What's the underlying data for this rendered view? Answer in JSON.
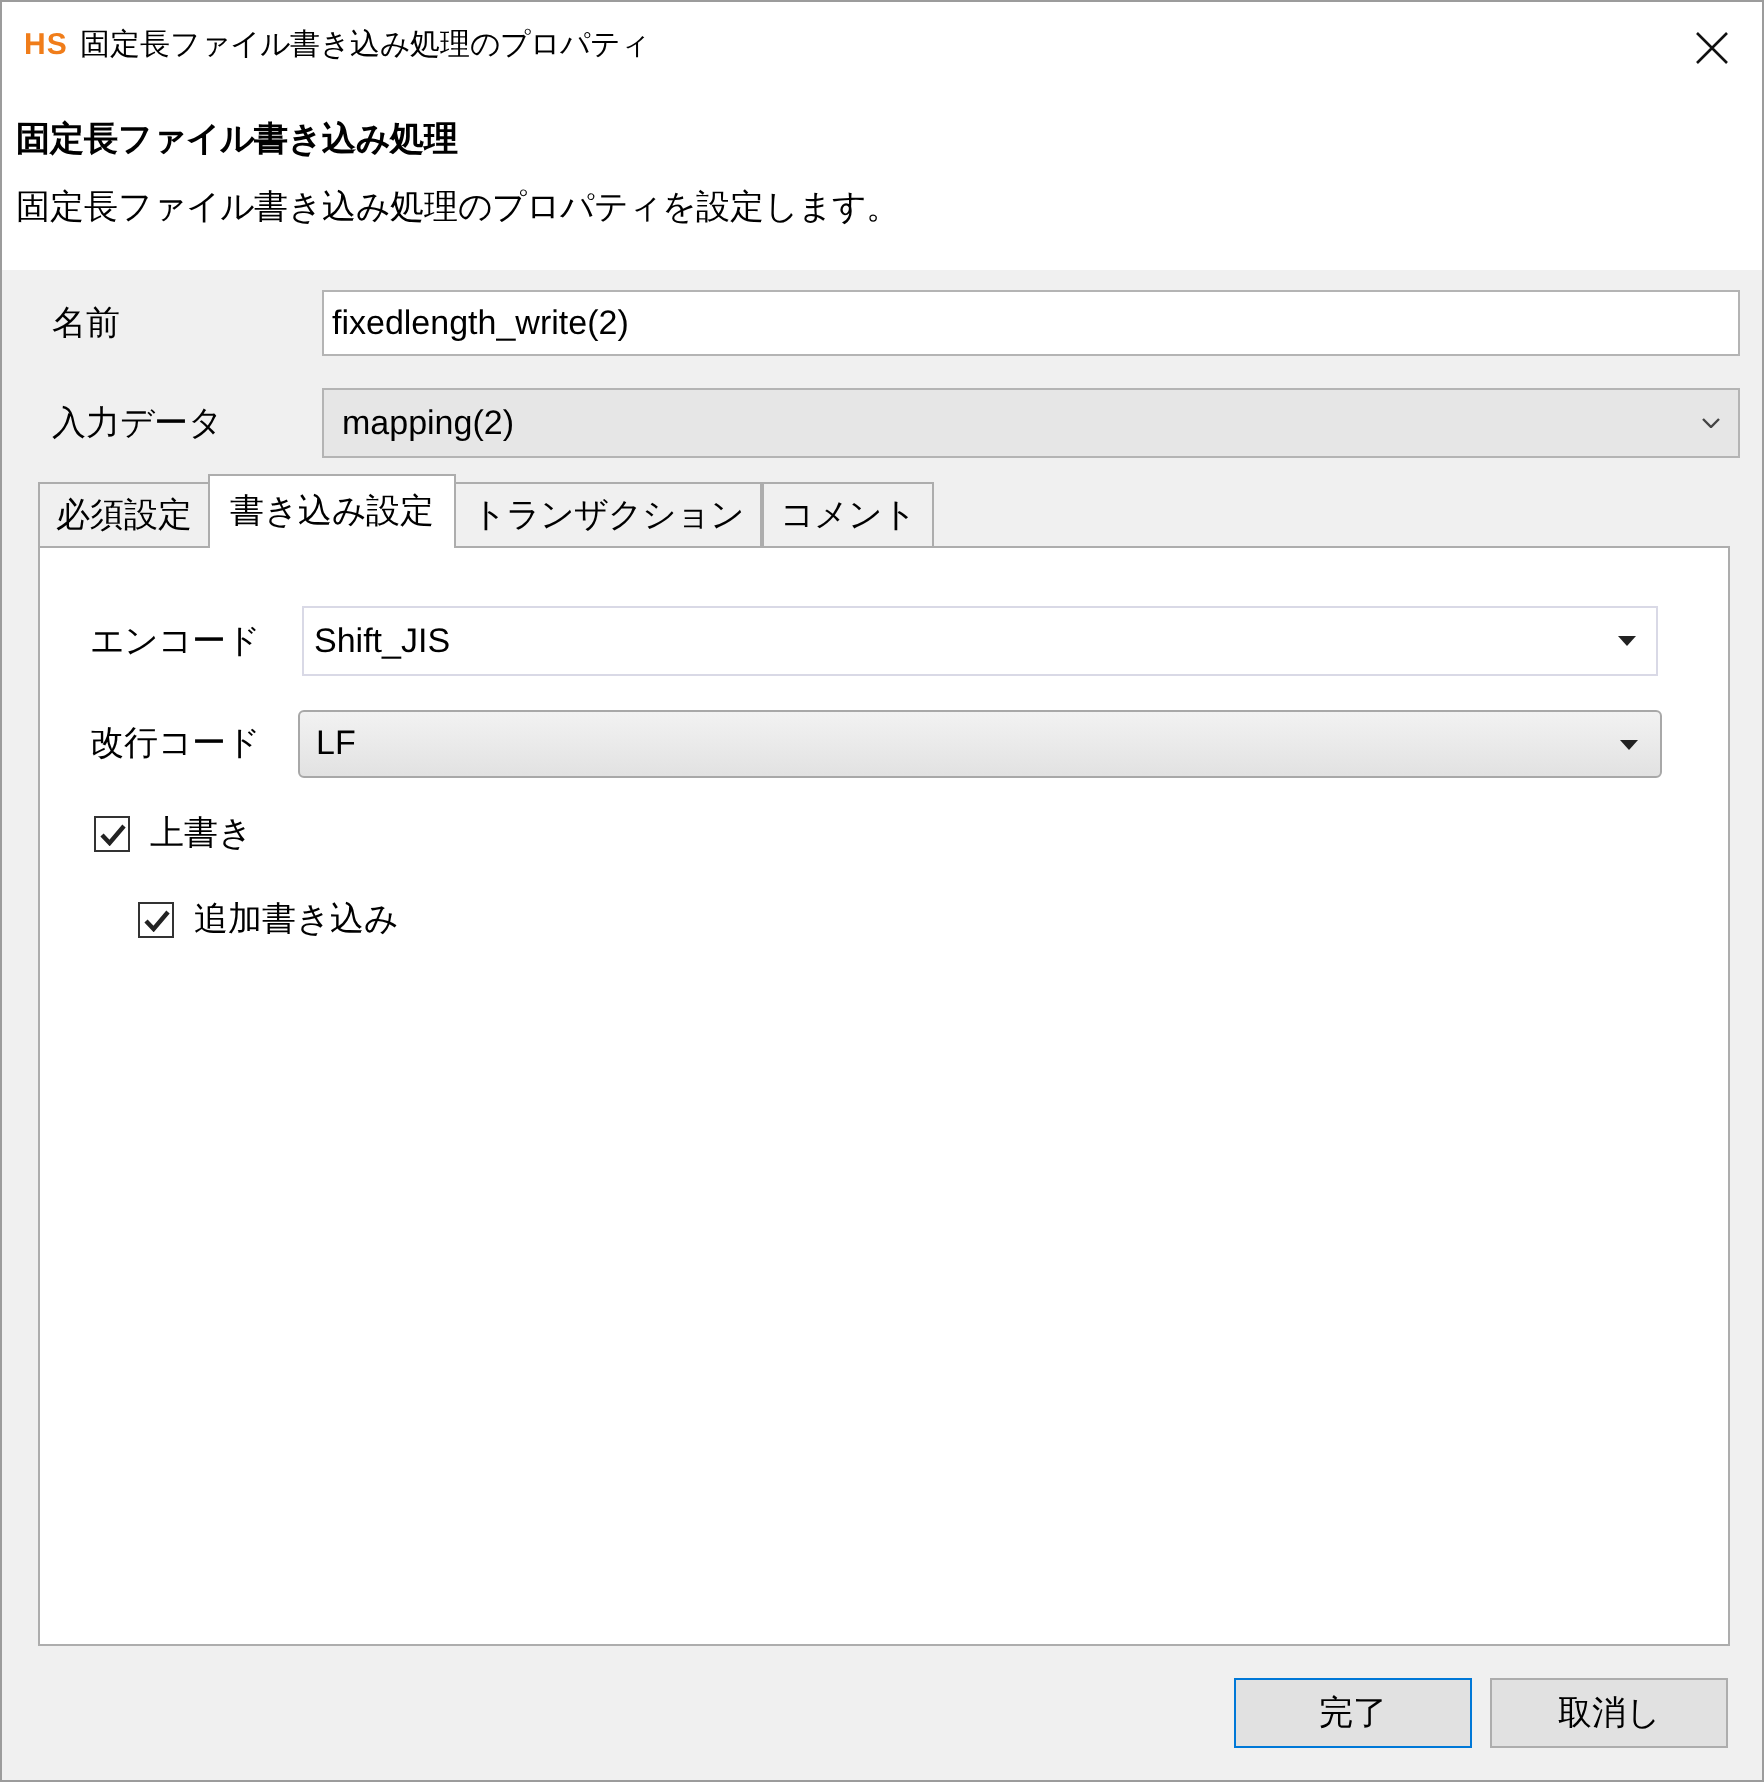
{
  "window": {
    "logo": "HS",
    "title": "固定長ファイル書き込み処理のプロパティ"
  },
  "header": {
    "title": "固定長ファイル書き込み処理",
    "description": "固定長ファイル書き込み処理のプロパティを設定します。"
  },
  "fields": [
    {
      "kind": "text",
      "label": "名前",
      "value": "fixedlength_write(2)"
    },
    {
      "kind": "dropdown",
      "label": "入力データ",
      "value": "mapping(2)"
    }
  ],
  "tabs": [
    {
      "label": "必須設定",
      "selected": false
    },
    {
      "label": "書き込み設定",
      "selected": true
    },
    {
      "label": "トランザクション",
      "selected": false
    },
    {
      "label": "コメント",
      "selected": false
    }
  ],
  "tab_panel": {
    "fields": [
      {
        "kind": "combo",
        "label": "エンコード",
        "value": "Shift_JIS"
      },
      {
        "kind": "choice",
        "label": "改行コード",
        "value": "LF"
      }
    ],
    "checkboxes": [
      {
        "label": "上書き",
        "checked": true,
        "children": [
          {
            "label": "追加書き込み",
            "checked": true
          }
        ]
      }
    ]
  },
  "buttons": [
    {
      "label": "完了",
      "default": true
    },
    {
      "label": "取消し",
      "default": false
    }
  ]
}
